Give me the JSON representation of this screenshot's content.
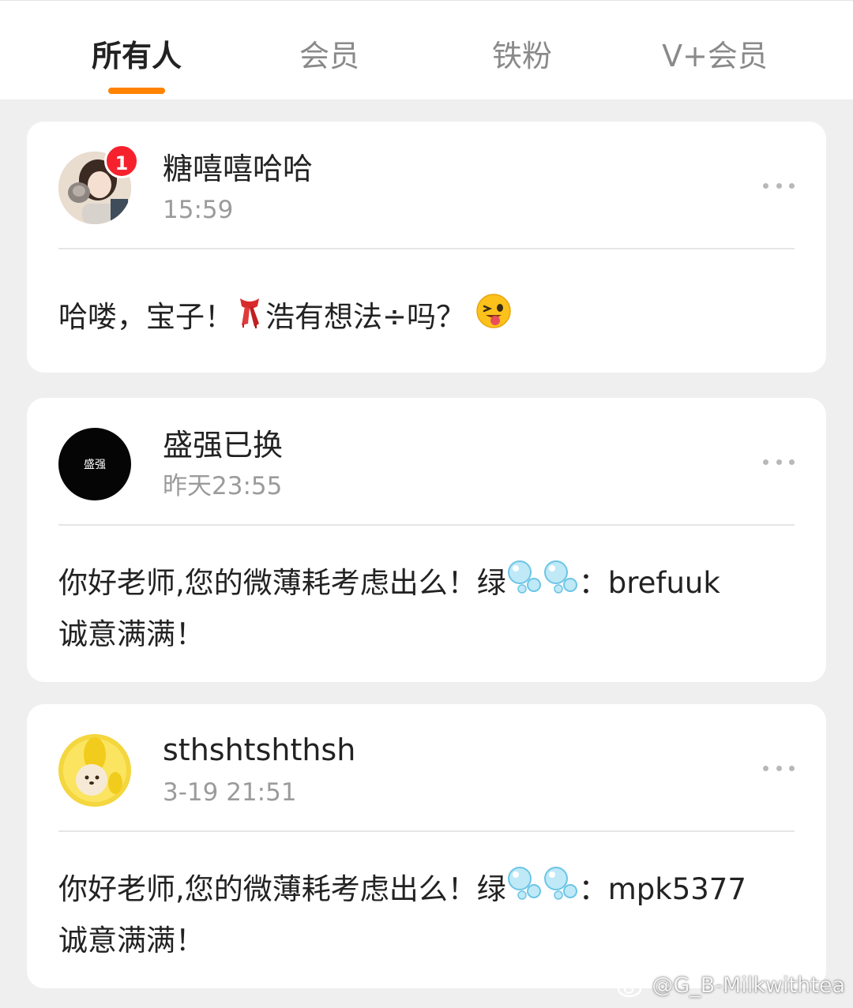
{
  "tabs": [
    {
      "label": "所有人",
      "active": true
    },
    {
      "label": "会员",
      "active": false
    },
    {
      "label": "铁粉",
      "active": false
    },
    {
      "label": "V+会员",
      "active": false
    }
  ],
  "accent_color": "#ff8200",
  "badge_color": "#f5222d",
  "messages": [
    {
      "name": "糖嘻嘻哈哈",
      "time": "15:59",
      "unread": "1",
      "text_part1": "哈喽，宝子！",
      "text_part2": "浩有想法÷吗？",
      "icons": [
        "scarf-emoji-icon",
        "wink-tongue-emoji-icon"
      ]
    },
    {
      "name": "盛强已换",
      "time": "昨天23:55",
      "avatar_text": "盛强",
      "text_part1": "你好老师,您的微薄耗考虑出么！绿",
      "text_part2": "：brefuuk",
      "text_line2": "诚意满满！",
      "icons": [
        "bubbles-icon",
        "bubbles-icon"
      ]
    },
    {
      "name": "sthshtshthsh",
      "time": "3-19 21:51",
      "text_part1": "你好老师,您的微薄耗考虑出么！绿",
      "text_part2": "：mpk5377",
      "text_line2": "诚意满满！",
      "icons": [
        "bubbles-icon",
        "bubbles-icon"
      ]
    }
  ],
  "watermark": "@G_B-Milkwithtea"
}
